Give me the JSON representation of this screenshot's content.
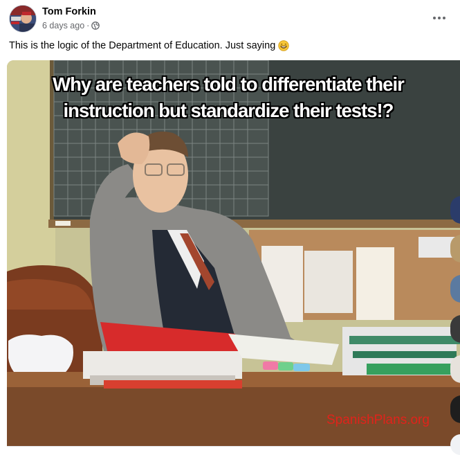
{
  "post": {
    "author": "Tom Forkin",
    "time": "6 days ago",
    "separator": "·",
    "audience_icon": "globe-icon",
    "more_icon": "more-options-icon",
    "text": "This is the logic of the Department of Education. Just saying",
    "emoji": "grinning-face-icon"
  },
  "media": {
    "caption_line1": "Why are teachers told to differentiate their",
    "caption_line2": "instruction but standardize their tests!?",
    "watermark": "SpanishPlans.org"
  },
  "colors": {
    "meta_text": "#65676b",
    "watermark": "#e0231b"
  }
}
